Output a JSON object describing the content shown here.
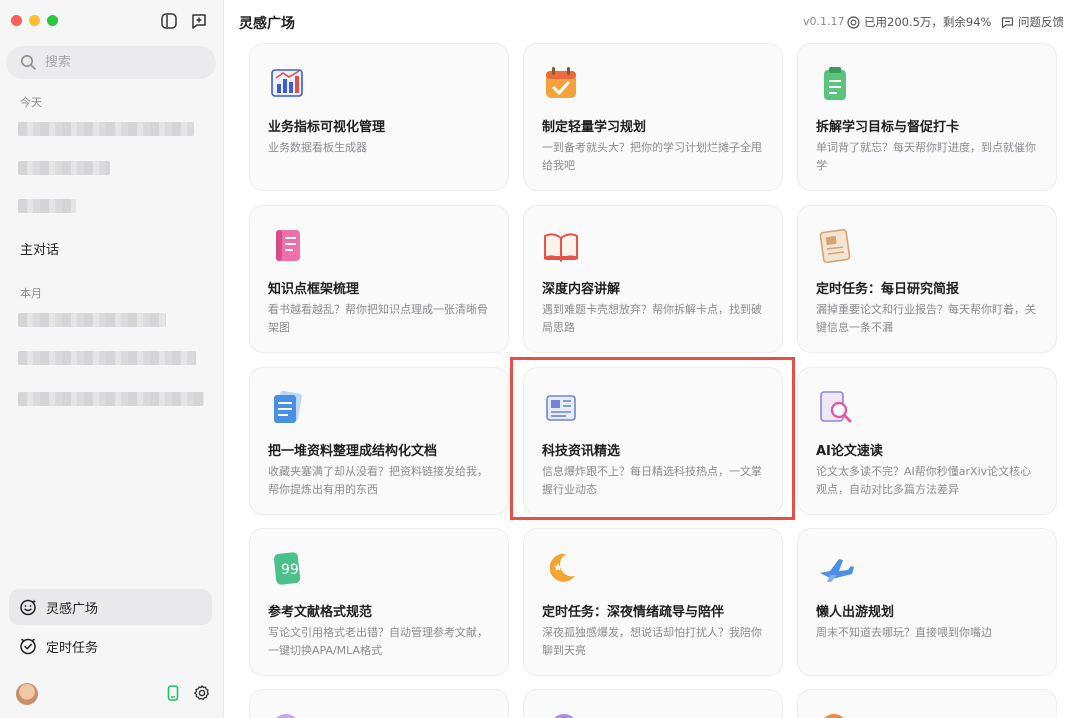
{
  "sidebar": {
    "search_placeholder": "搜索",
    "section_today": "今天",
    "main_chat": "主对话",
    "section_month": "本月",
    "nav": [
      {
        "label": "灵感广场",
        "icon": "smile-sparkle-icon",
        "active": true
      },
      {
        "label": "定时任务",
        "icon": "clock-check-icon",
        "active": false
      }
    ]
  },
  "header": {
    "title": "灵感广场",
    "version": "v0.1.17",
    "usage": "已用200.5万，剩余94%",
    "feedback": "问题反馈"
  },
  "cards": [
    {
      "title": "业务指标可视化管理",
      "desc": "业务数据看板生成器",
      "icon": "bar-chart-icon",
      "color": "#3b5bdb"
    },
    {
      "title": "制定轻量学习规划",
      "desc": "一到备考就头大？把你的学习计划烂摊子全甩给我吧",
      "icon": "calendar-check-icon",
      "color": "#f4a23b"
    },
    {
      "title": "拆解学习目标与督促打卡",
      "desc": "单词背了就忘？每天帮你盯进度，到点就催你学",
      "icon": "clipboard-icon",
      "color": "#5ac47d"
    },
    {
      "title": "知识点框架梳理",
      "desc": "看书越看越乱？帮你把知识点理成一张清晰骨架图",
      "icon": "notebook-icon",
      "color": "#ef6fa8"
    },
    {
      "title": "深度内容讲解",
      "desc": "遇到难题卡壳想放弃？帮你拆解卡点，找到破局思路",
      "icon": "open-book-icon",
      "color": "#e5534b"
    },
    {
      "title": "定时任务：每日研究简报",
      "desc": "漏掉重要论文和行业报告？每天帮你盯着，关键信息一条不漏",
      "icon": "newspaper-icon",
      "color": "#d9a273"
    },
    {
      "title": "把一堆资料整理成结构化文档",
      "desc": "收藏夹塞满了却从没看？把资料链接发给我，帮你提炼出有用的东西",
      "icon": "documents-icon",
      "color": "#4a90e2"
    },
    {
      "title": "科技资讯精选",
      "desc": "信息爆炸跟不上？每日精选科技热点，一文掌握行业动态",
      "icon": "tech-news-icon",
      "color": "#6f86d6"
    },
    {
      "title": "AI论文速读",
      "desc": "论文太多读不完？AI帮你秒懂arXiv论文核心观点，自动对比多篇方法差异",
      "icon": "paper-magnifier-icon",
      "color": "#9b7fe0"
    },
    {
      "title": "参考文献格式规范",
      "desc": "写论文引用格式老出错？自动管理参考文献，一键切换APA/MLA格式",
      "icon": "quote-card-icon",
      "color": "#4cc08a"
    },
    {
      "title": "定时任务：深夜情绪疏导与陪伴",
      "desc": "深夜孤独感爆发，想说话却怕打扰人？我陪你聊到天亮",
      "icon": "moon-icon",
      "color": "#f3a531"
    },
    {
      "title": "懒人出游规划",
      "desc": "周末不知道去哪玩？直接喂到你嘴边",
      "icon": "airplane-icon",
      "color": "#4d8fe6"
    }
  ]
}
